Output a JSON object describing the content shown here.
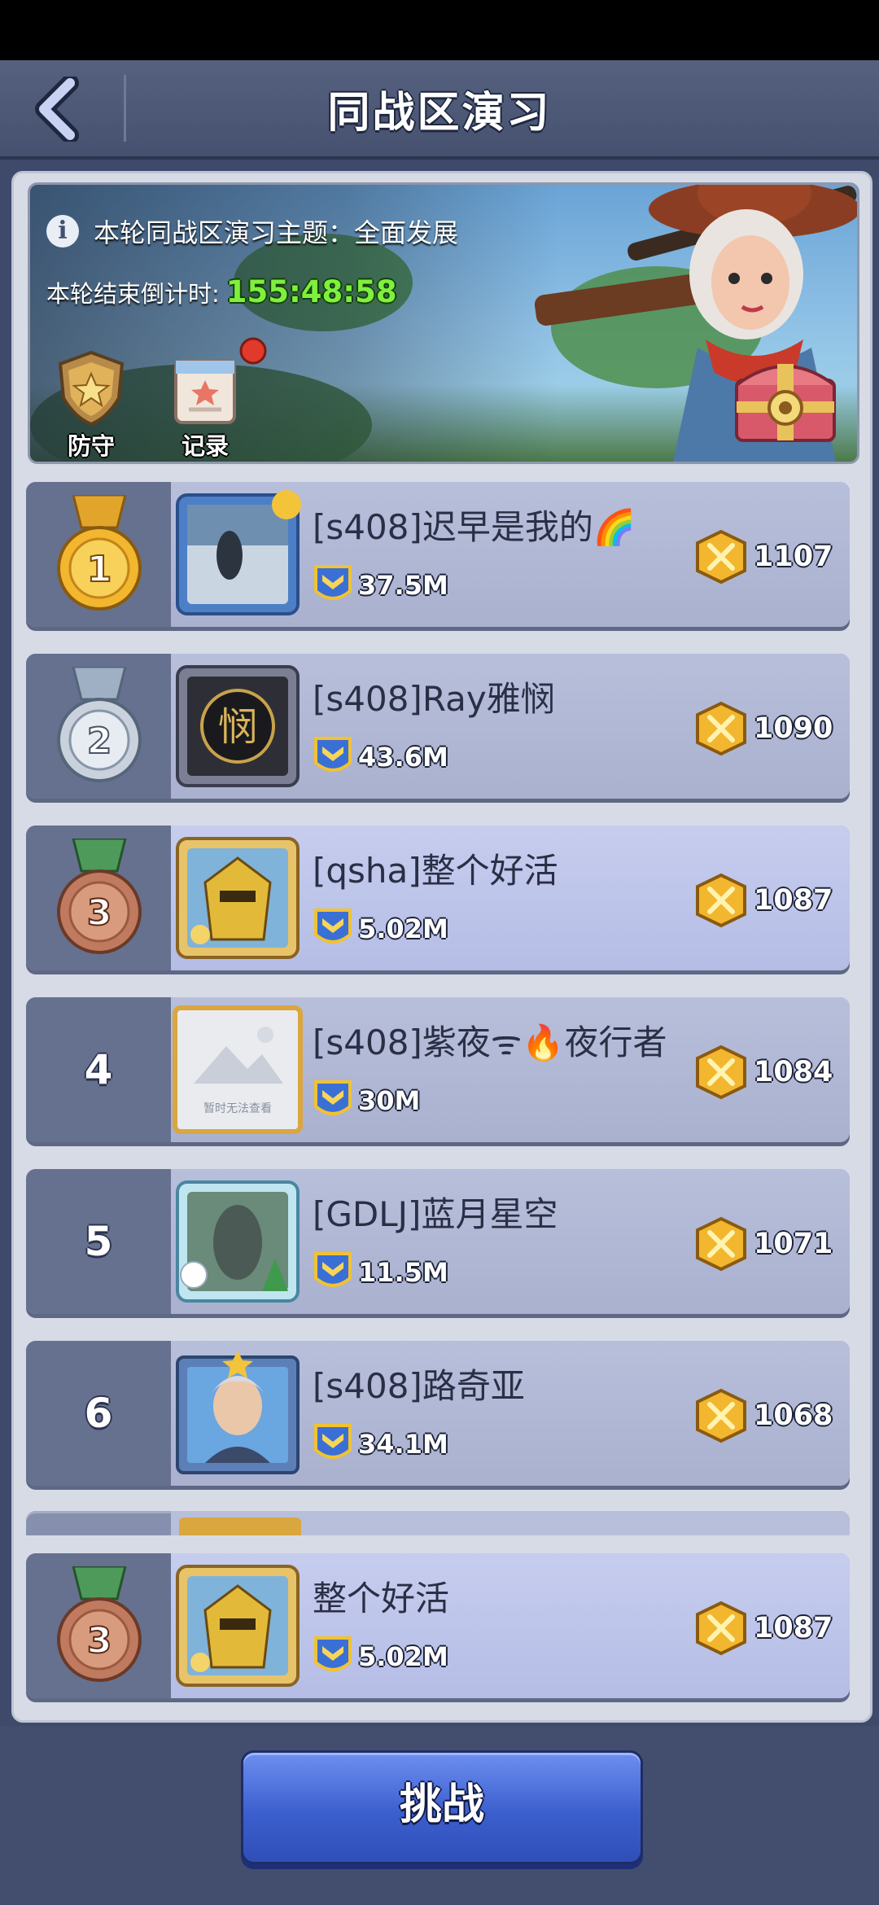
{
  "header": {
    "title": "同战区演习"
  },
  "banner": {
    "theme_text": "本轮同战区演习主题：全面发展",
    "countdown_label": "本轮结束倒计时:",
    "countdown_value": "155:48:58",
    "defense_label": "防守",
    "record_label": "记录"
  },
  "rankings": [
    {
      "rank": "1",
      "name": "[s408]迟早是我的🌈",
      "power": "37.5M",
      "score": "1107"
    },
    {
      "rank": "2",
      "name": "[s408]Ray雅悯",
      "power": "43.6M",
      "score": "1090"
    },
    {
      "rank": "3",
      "name": "[qsha]整个好活",
      "power": "5.02M",
      "score": "1087"
    },
    {
      "rank": "4",
      "name": "[s408]紫夜ᯤ🔥夜行者",
      "power": "30M",
      "score": "1084",
      "avatar_caption": "暂时无法查看"
    },
    {
      "rank": "5",
      "name": "[GDLJ]蓝月星空",
      "power": "11.5M",
      "score": "1071"
    },
    {
      "rank": "6",
      "name": "[s408]路奇亚",
      "power": "34.1M",
      "score": "1068"
    }
  ],
  "my_entry": {
    "rank": "3",
    "name": "整个好活",
    "power": "5.02M",
    "score": "1087"
  },
  "footer": {
    "challenge_label": "挑战"
  },
  "colors": {
    "gold": "#f2b62f",
    "silver": "#c9d2dc",
    "bronze": "#c07a5f",
    "green": "#7ff03d",
    "button": "#3c5fcf"
  }
}
